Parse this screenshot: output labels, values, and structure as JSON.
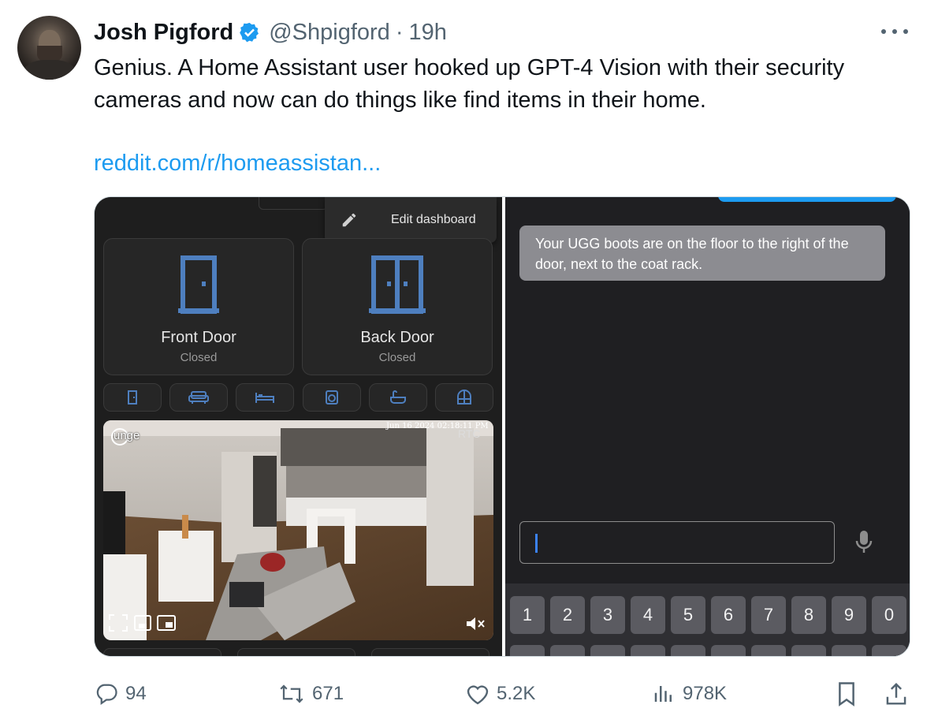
{
  "tweet": {
    "author_name": "Josh Pigford",
    "handle": "@Shpigford",
    "separator": "·",
    "time": "19h",
    "text": "Genius. A Home Assistant user hooked up GPT-4 Vision with their security cameras and now can do things like find items in their home.",
    "link": "reddit.com/r/homeassistan..."
  },
  "media": {
    "left": {
      "menu_label": "Edit dashboard",
      "cards": [
        {
          "title": "Front Door",
          "state": "Closed",
          "icon": "door-icon"
        },
        {
          "title": "Back Door",
          "state": "Closed",
          "icon": "double-door-icon"
        }
      ],
      "chips": [
        "door-icon",
        "sofa-icon",
        "bed-icon",
        "washer-icon",
        "bathtub-icon",
        "window-icon"
      ],
      "camera": {
        "label": "unge",
        "date": "Jun 16 2024   02:18:11 PM",
        "source": "RTC"
      }
    },
    "right": {
      "reply": "Your UGG boots are on the floor to the right of the door, next to the coat rack.",
      "keys": [
        "1",
        "2",
        "3",
        "4",
        "5",
        "6",
        "7",
        "8",
        "9",
        "0"
      ]
    }
  },
  "stats": {
    "replies": "94",
    "reposts": "671",
    "likes": "5.2K",
    "views": "978K"
  },
  "colors": {
    "link": "#1d9bf0",
    "muted": "#536471",
    "verified": "#1d9bf0",
    "ha_icon": "#4e7fbf"
  }
}
